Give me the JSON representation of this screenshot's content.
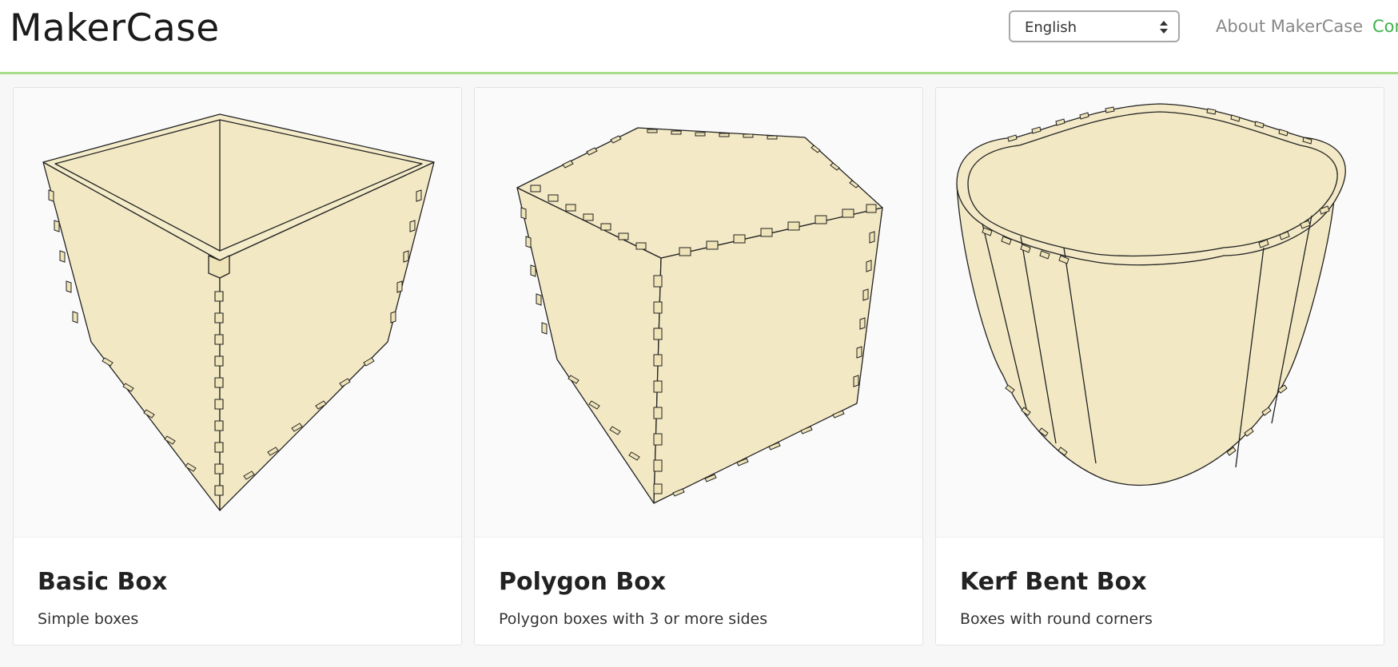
{
  "header": {
    "brand": "MakerCase",
    "language_select": {
      "value": "English"
    },
    "nav": {
      "about": "About MakerCase",
      "contact": "Con"
    }
  },
  "colors": {
    "accent_line": "#a6dc8a",
    "contact_link": "#3db34a",
    "wood": "#f2e8c4"
  },
  "cards": [
    {
      "title": "Basic Box",
      "description": "Simple boxes",
      "image": "basic-box-render"
    },
    {
      "title": "Polygon Box",
      "description": "Polygon boxes with 3 or more sides",
      "image": "polygon-box-render"
    },
    {
      "title": "Kerf Bent Box",
      "description": "Boxes with round corners",
      "image": "kerf-bent-box-render"
    }
  ]
}
